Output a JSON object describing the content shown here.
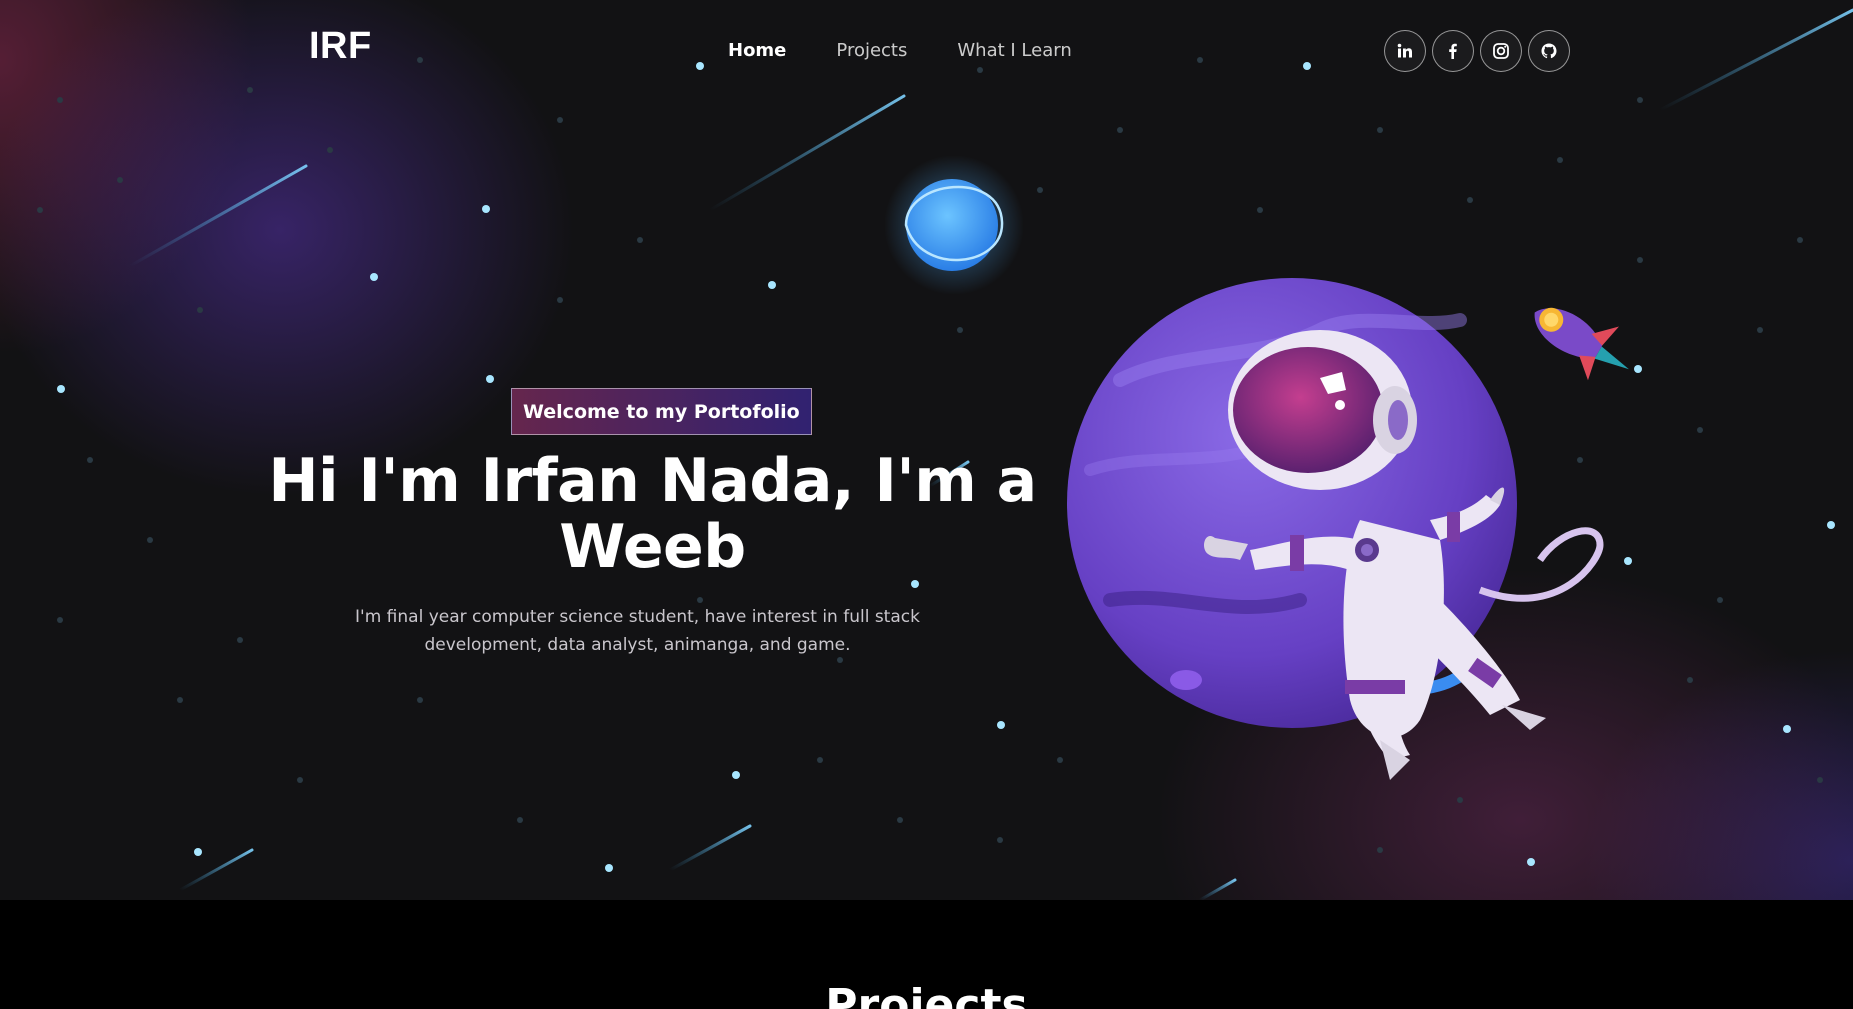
{
  "nav": {
    "logo": "IRF",
    "links": [
      {
        "label": "Home",
        "active": true
      },
      {
        "label": "Projects",
        "active": false
      },
      {
        "label": "What I Learn",
        "active": false
      }
    ],
    "social": [
      {
        "icon": "linkedin-icon"
      },
      {
        "icon": "facebook-icon"
      },
      {
        "icon": "instagram-icon"
      },
      {
        "icon": "github-icon"
      }
    ]
  },
  "hero": {
    "tagline": "Welcome to my Portofolio",
    "title": "Hi I'm Irfan Nada, I'm a Weeb",
    "description": "I'm final year computer science student, have interest in full stack development, data analyst, animanga, and game."
  },
  "projects": {
    "title": "Projects"
  },
  "colors": {
    "background": "#121214",
    "accent_pink": "#aa367c",
    "accent_purple": "#4a2fbd",
    "star": "#9fe4ff"
  }
}
